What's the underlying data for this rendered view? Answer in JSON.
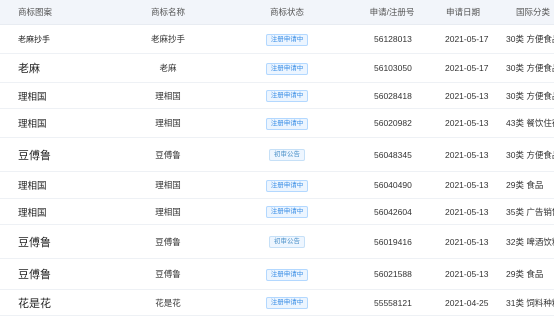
{
  "table": {
    "headers": {
      "logo": "商标图案",
      "name": "商标名称",
      "status": "商标状态",
      "regno": "申请/注册号",
      "date": "申请日期",
      "cls": "国际分类"
    },
    "rows": [
      {
        "logo": "老麻抄手",
        "name": "老麻抄手",
        "status": "注册申请中",
        "regno": "56128013",
        "date": "2021-05-17",
        "cls": "30类 方便食品",
        "logo_size": "small"
      },
      {
        "logo": "老麻",
        "name": "老麻",
        "status": "注册申请中",
        "regno": "56103050",
        "date": "2021-05-17",
        "cls": "30类 方便食品",
        "logo_size": "large"
      },
      {
        "logo": "理相国",
        "name": "理相国",
        "status": "注册申请中",
        "regno": "56028418",
        "date": "2021-05-13",
        "cls": "30类 方便食品",
        "logo_size": "medium"
      },
      {
        "logo": "理相国",
        "name": "理相国",
        "status": "注册申请中",
        "regno": "56020982",
        "date": "2021-05-13",
        "cls": "43类 餐饮住宿",
        "logo_size": "medium"
      },
      {
        "logo": "豆傅鲁",
        "name": "豆傅鲁",
        "status": "初审公告",
        "regno": "56048345",
        "date": "2021-05-13",
        "cls": "30类 方便食品",
        "logo_size": "large"
      },
      {
        "logo": "理相国",
        "name": "理相国",
        "status": "注册申请中",
        "regno": "56040490",
        "date": "2021-05-13",
        "cls": "29类 食品",
        "logo_size": "medium"
      },
      {
        "logo": "理相国",
        "name": "理相国",
        "status": "注册申请中",
        "regno": "56042604",
        "date": "2021-05-13",
        "cls": "35类 广告销售",
        "logo_size": "medium"
      },
      {
        "logo": "豆傅鲁",
        "name": "豆傅鲁",
        "status": "初审公告",
        "regno": "56019416",
        "date": "2021-05-13",
        "cls": "32类 啤酒饮料",
        "logo_size": "large"
      },
      {
        "logo": "豆傅鲁",
        "name": "豆傅鲁",
        "status": "注册申请中",
        "regno": "56021588",
        "date": "2021-05-13",
        "cls": "29类 食品",
        "logo_size": "large"
      },
      {
        "logo": "花是花",
        "name": "花是花",
        "status": "注册申请中",
        "regno": "55558121",
        "date": "2021-04-25",
        "cls": "31类 饲料种籽",
        "logo_size": "large"
      }
    ]
  }
}
